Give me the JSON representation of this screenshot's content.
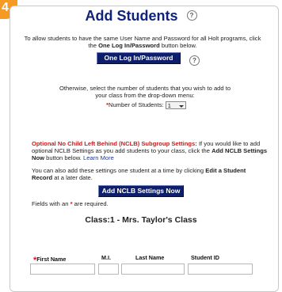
{
  "corner_badge": "4",
  "page_title": "Add Students",
  "intro_text_1": "To allow students to have the same User Name and Password for all Holt programs, click the",
  "intro_bold": "One Log In/Password",
  "intro_text_2": "button below.",
  "one_login_button": "One Log In/Password",
  "otherwise_text": "Otherwise, select the number of students that you wish to add to your class from the drop-down menu:",
  "number_label": "Number of Students:",
  "number_value": "1",
  "nclb_heading": "Optional No Child Left Behind (NCLB) Subgroup Settings:",
  "nclb_text_1": "If you would like to add optional NCLB Settings as you add students to your class, click the",
  "nclb_bold": "Add NCLB Settings Now",
  "nclb_text_2": "button below.",
  "learn_more": "Learn More",
  "one_at_time_1": "You can also add these settings one student at a time by clicking",
  "one_at_time_bold": "Edit a Student Record",
  "one_at_time_2": "at a later date.",
  "add_nclb_button": "Add NCLB Settings Now",
  "required_note_1": "Fields with an",
  "required_note_2": "are required.",
  "class_heading": "Class:1 - Mrs. Taylor's Class",
  "columns": {
    "first_name": "First Name",
    "mi": "M.I.",
    "last_name": "Last Name",
    "student_id": "Student ID"
  },
  "required_star": "*",
  "colors": {
    "title": "#10237a",
    "button": "#0d1f6b",
    "accent": "#f59a23",
    "required": "#dd1111"
  }
}
